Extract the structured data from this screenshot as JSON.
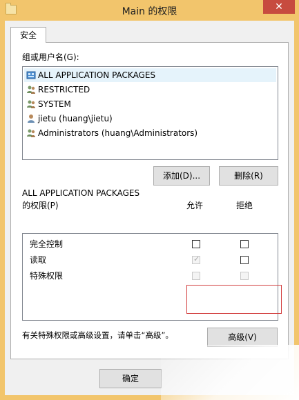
{
  "window": {
    "title": "Main 的权限",
    "close_label": "✕"
  },
  "tabs": [
    {
      "label": "安全",
      "selected": true
    }
  ],
  "groups": {
    "label": "组或用户名(G):",
    "items": [
      {
        "name": "ALL APPLICATION PACKAGES",
        "icon": "package-group-icon",
        "selected": true
      },
      {
        "name": "RESTRICTED",
        "icon": "users-group-icon",
        "selected": false
      },
      {
        "name": "SYSTEM",
        "icon": "users-group-icon",
        "selected": false
      },
      {
        "name": "jietu (huang\\jietu)",
        "icon": "user-icon",
        "selected": false
      },
      {
        "name": "Administrators (huang\\Administrators)",
        "icon": "users-group-icon",
        "selected": false
      }
    ]
  },
  "buttons": {
    "add": "添加(D)...",
    "remove": "删除(R)",
    "advanced": "高级(V)",
    "ok": "确定"
  },
  "permissions": {
    "for_label": "ALL APPLICATION PACKAGES",
    "label": "的权限(P)",
    "allow_header": "允许",
    "deny_header": "拒绝",
    "rows": [
      {
        "name": "完全控制",
        "allow": false,
        "deny": false,
        "enabled": true
      },
      {
        "name": "读取",
        "allow": true,
        "deny": false,
        "enabled": true
      },
      {
        "name": "特殊权限",
        "allow": false,
        "deny": false,
        "enabled": false
      }
    ]
  },
  "advanced_hint": "有关特殊权限或高级设置，请单击“高级”。",
  "colors": {
    "titlebar": "#f2c56c",
    "close": "#c74b3f",
    "highlight_border": "#d23c3c"
  }
}
